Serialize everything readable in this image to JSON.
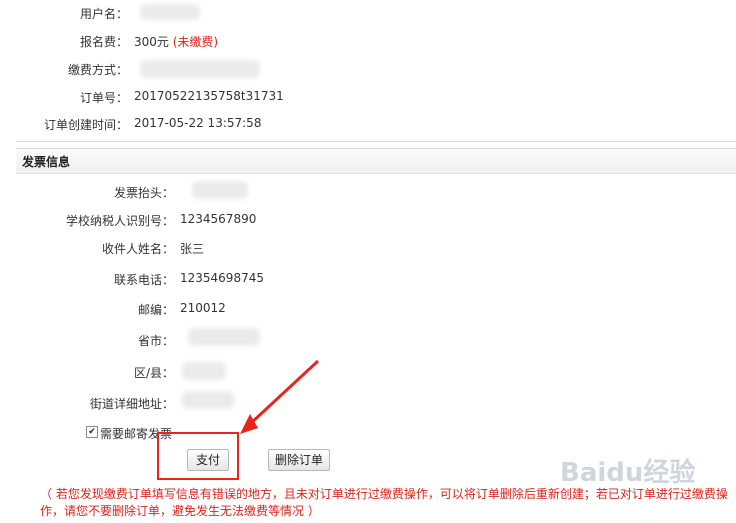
{
  "order": {
    "username_label": "用户名：",
    "fee_label": "报名费：",
    "fee_value": "300元",
    "fee_status": "(未缴费)",
    "payment_method_label": "缴费方式：",
    "order_no_label": "订单号：",
    "order_no_value": "20170522135758t31731",
    "created_label": "订单创建时间：",
    "created_value": "2017-05-22 13:57:58"
  },
  "invoice": {
    "section_title": "发票信息",
    "title_label": "发票抬头：",
    "taxpayer_label": "学校纳税人识别号：",
    "taxpayer_value": "1234567890",
    "recipient_label": "收件人姓名：",
    "recipient_value": "张三",
    "phone_label": "联系电话：",
    "phone_value": "12354698745",
    "postcode_label": "邮编：",
    "postcode_value": "210012",
    "province_label": "省市：",
    "district_label": "区/县：",
    "street_label": "街道详细地址：",
    "mail_checkbox_label": "需要邮寄发票"
  },
  "actions": {
    "pay_label": "支付",
    "delete_label": "删除订单"
  },
  "notice": "（ 若您发现缴费订单填写信息有错误的地方，且未对订单进行过缴费操作，可以将订单删除后重新创建；若已对订单进行过缴费操作，请您不要删除订单，避免发生无法缴费等情况 ）",
  "watermark": "Baidu经验",
  "colors": {
    "accent_red": "#d9251d",
    "highlight_box": "#e8251d"
  }
}
